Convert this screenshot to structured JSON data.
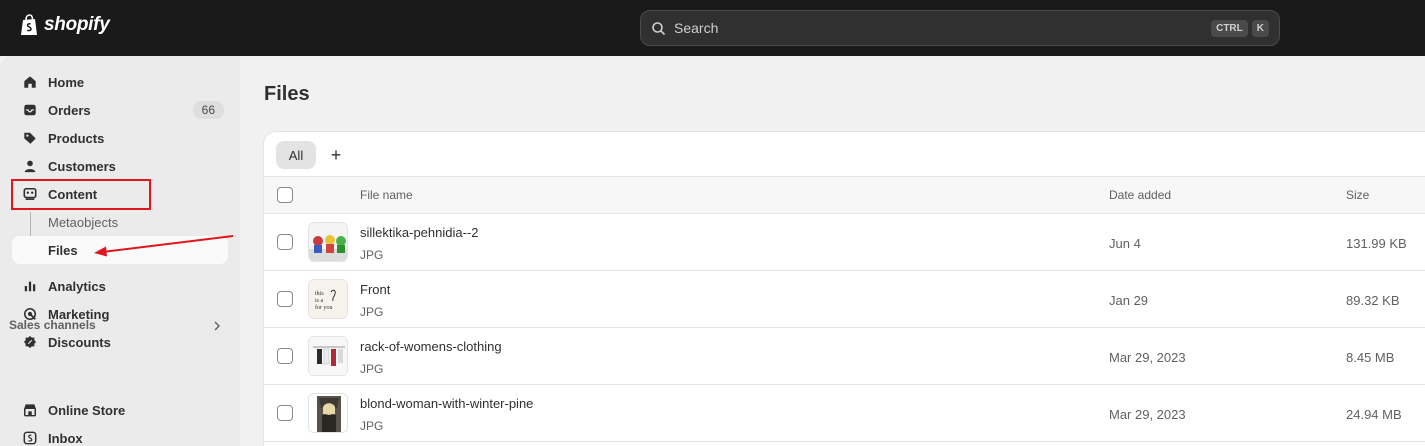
{
  "app": {
    "logo_text": "shopify"
  },
  "search": {
    "placeholder": "Search",
    "shortcut_keys": [
      "CTRL",
      "K"
    ]
  },
  "sidebar": {
    "items": [
      {
        "label": "Home",
        "icon": "home-icon"
      },
      {
        "label": "Orders",
        "icon": "orders-icon",
        "badge": "66"
      },
      {
        "label": "Products",
        "icon": "tag-icon"
      },
      {
        "label": "Customers",
        "icon": "person-icon"
      },
      {
        "label": "Content",
        "icon": "content-icon"
      }
    ],
    "content_subitems": [
      {
        "label": "Metaobjects"
      },
      {
        "label": "Files",
        "active": true
      }
    ],
    "items2": [
      {
        "label": "Analytics",
        "icon": "bar-chart-icon"
      },
      {
        "label": "Marketing",
        "icon": "target-icon"
      },
      {
        "label": "Discounts",
        "icon": "discount-icon"
      }
    ],
    "sales_channels_label": "Sales channels",
    "channels": [
      {
        "label": "Online Store",
        "icon": "store-icon"
      },
      {
        "label": "Inbox",
        "icon": "inbox-icon"
      }
    ]
  },
  "page": {
    "title": "Files"
  },
  "tabs": {
    "all_label": "All",
    "add_label": "+"
  },
  "table": {
    "headers": {
      "file_name": "File name",
      "date_added": "Date added",
      "size": "Size"
    },
    "rows": [
      {
        "name": "sillektika-pehnidia--2",
        "type": "JPG",
        "date": "Jun 4",
        "size": "131.99 KB"
      },
      {
        "name": "Front",
        "type": "JPG",
        "date": "Jan 29",
        "size": "89.32 KB"
      },
      {
        "name": "rack-of-womens-clothing",
        "type": "JPG",
        "date": "Mar 29, 2023",
        "size": "8.45 MB"
      },
      {
        "name": "blond-woman-with-winter-pine",
        "type": "JPG",
        "date": "Mar 29, 2023",
        "size": "24.94 MB"
      }
    ]
  },
  "thumb_texts": {
    "front": [
      "this",
      "is a",
      "for you"
    ]
  },
  "colors": {
    "topbar": "#1a1a1a",
    "highlight": "#e0161e",
    "accent_sidebar": "#ebebeb"
  }
}
